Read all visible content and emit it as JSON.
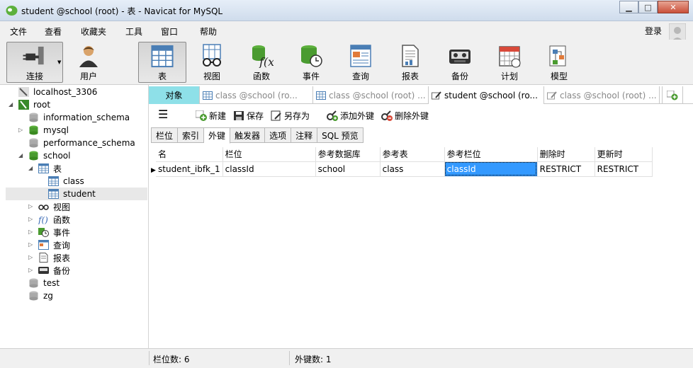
{
  "window": {
    "title": "student @school (root) - 表 - Navicat for MySQL"
  },
  "menu": {
    "items": [
      "文件",
      "查看",
      "收藏夹",
      "工具",
      "窗口",
      "帮助"
    ],
    "login": "登录"
  },
  "toolbar": {
    "buttons": [
      {
        "label": "连接",
        "icon": "connection-plug-icon"
      },
      {
        "label": "用户",
        "icon": "user-icon"
      },
      {
        "label": "表",
        "icon": "table-icon"
      },
      {
        "label": "视图",
        "icon": "view-glasses-icon"
      },
      {
        "label": "函数",
        "icon": "function-icon"
      },
      {
        "label": "事件",
        "icon": "event-clock-icon"
      },
      {
        "label": "查询",
        "icon": "query-icon"
      },
      {
        "label": "报表",
        "icon": "report-icon"
      },
      {
        "label": "备份",
        "icon": "backup-icon"
      },
      {
        "label": "计划",
        "icon": "schedule-calendar-icon"
      },
      {
        "label": "模型",
        "icon": "model-icon"
      }
    ]
  },
  "tree": {
    "items": [
      {
        "label": "localhost_3306",
        "icon": "connection-icon"
      },
      {
        "label": "root",
        "icon": "connection-icon"
      },
      {
        "label": "information_schema",
        "icon": "database-icon"
      },
      {
        "label": "mysql",
        "icon": "database-icon"
      },
      {
        "label": "performance_schema",
        "icon": "database-icon"
      },
      {
        "label": "school",
        "icon": "database-icon"
      },
      {
        "label": "表",
        "icon": "table-icon"
      },
      {
        "label": "class",
        "icon": "table-icon"
      },
      {
        "label": "student",
        "icon": "table-icon"
      },
      {
        "label": "视图",
        "icon": "view-glasses-icon"
      },
      {
        "label": "函数",
        "icon": "function-icon"
      },
      {
        "label": "事件",
        "icon": "event-clock-icon"
      },
      {
        "label": "查询",
        "icon": "query-icon"
      },
      {
        "label": "报表",
        "icon": "report-icon"
      },
      {
        "label": "备份",
        "icon": "backup-icon"
      },
      {
        "label": "test",
        "icon": "database-icon"
      },
      {
        "label": "zg",
        "icon": "database-icon"
      }
    ]
  },
  "tabs": {
    "object": "对象",
    "items": [
      {
        "label": "class @school (ro..."
      },
      {
        "label": "class @school (root) ..."
      },
      {
        "label": "student @school (ro..."
      },
      {
        "label": "class @school (root) ..."
      }
    ]
  },
  "actions": {
    "new": "新建",
    "save": "保存",
    "save_as": "另存为",
    "add_fk": "添加外键",
    "delete_fk": "删除外键"
  },
  "subtabs": [
    "栏位",
    "索引",
    "外键",
    "触发器",
    "选项",
    "注释",
    "SQL 预览"
  ],
  "grid": {
    "columns": [
      "名",
      "栏位",
      "参考数据库",
      "参考表",
      "参考栏位",
      "删除时",
      "更新时"
    ],
    "rows": [
      [
        "student_ibfk_1",
        "classId",
        "school",
        "class",
        "classId",
        "RESTRICT",
        "RESTRICT"
      ]
    ]
  },
  "status": {
    "fields": "栏位数: 6",
    "fks": "外键数: 1"
  },
  "colors": {
    "object_tab": "#8ee0e8",
    "selection": "#3399ff",
    "db_green": "#4caf3a"
  }
}
